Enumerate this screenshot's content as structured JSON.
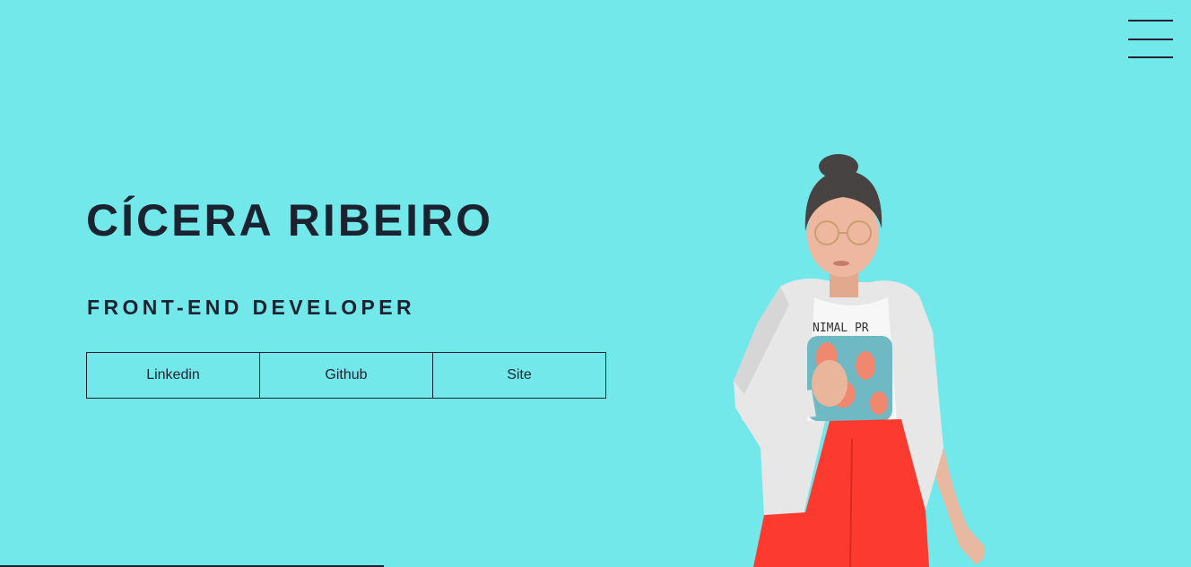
{
  "colors": {
    "background": "#72e8ea",
    "text": "#1c2330",
    "jacket": "#e7e7e7",
    "pants": "#fc3a30"
  },
  "header": {
    "menu_icon": "hamburger-menu-icon"
  },
  "hero": {
    "name": "CÍCERA RIBEIRO",
    "role": "FRONT-END DEVELOPER",
    "links": [
      {
        "label": "Linkedin"
      },
      {
        "label": "Github"
      },
      {
        "label": "Site"
      }
    ]
  },
  "portrait": {
    "shirt_text": "NIMAL PR"
  }
}
